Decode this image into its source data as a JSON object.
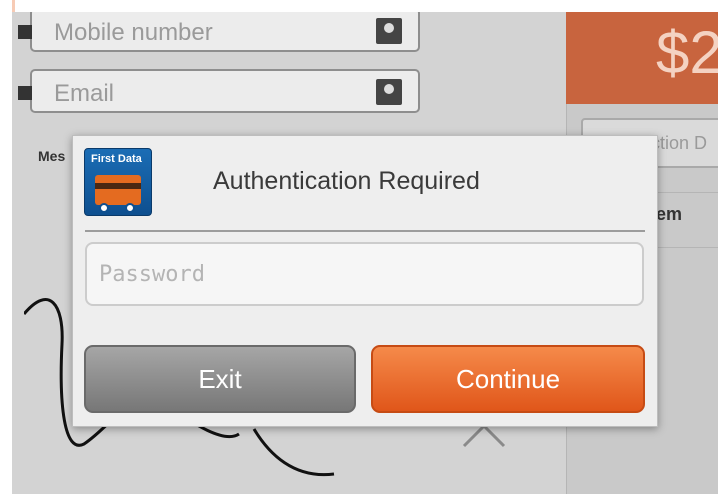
{
  "background": {
    "mobile_placeholder": "Mobile number",
    "email_placeholder": "Email",
    "message_label": "Mes",
    "price_partial": "$2",
    "transaction_partial": "ction D",
    "item_partial": "em"
  },
  "dialog": {
    "app_icon_brand": "First Data",
    "title": "Authentication Required",
    "password_placeholder": "Password",
    "password_value": "",
    "exit_label": "Exit",
    "continue_label": "Continue"
  },
  "colors": {
    "accent": "#e8601c",
    "exit_button": "#8a8a8a",
    "dialog_bg": "#eeeeee"
  }
}
